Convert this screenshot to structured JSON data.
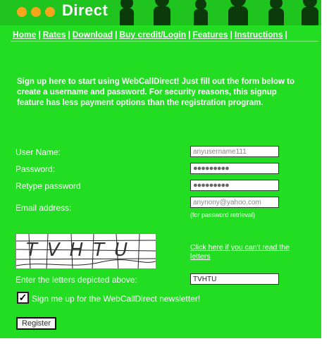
{
  "header": {
    "brand": "Direct"
  },
  "nav": {
    "items": [
      "Home",
      "Rates",
      "Download",
      "Buy credit/Login",
      "Features",
      "Instructions"
    ],
    "separator": "|"
  },
  "intro": "Sign up here to start using WebCallDirect! Just fill out the form below to create a username and password. For security reasons, this signup feature has less payment options than the registration program.",
  "form": {
    "username": {
      "label": "User Name:",
      "value": "anyusername111"
    },
    "password": {
      "label": "Password:",
      "value": "●●●●●●●●●"
    },
    "retype_password": {
      "label": "Retype password",
      "value": "●●●●●●●●●"
    },
    "email": {
      "label": "Email address:",
      "value": "anynony@yahoo.com",
      "hint": "(for password retrieval)"
    },
    "captcha": {
      "letters": "TVHTU",
      "cant_read_link": "Click here if you can't read the letters"
    },
    "captcha_entry": {
      "label": "Enter the letters depicted above:",
      "value": "TVHTU"
    },
    "newsletter": {
      "label": "Sign me up for the WebCallDirect newsletter!",
      "checked": true,
      "mark": "✓"
    },
    "register_label": "Register"
  },
  "colors": {
    "background": "#22dd22",
    "accent_orange": "#f6a51c",
    "text": "#ffffff"
  }
}
